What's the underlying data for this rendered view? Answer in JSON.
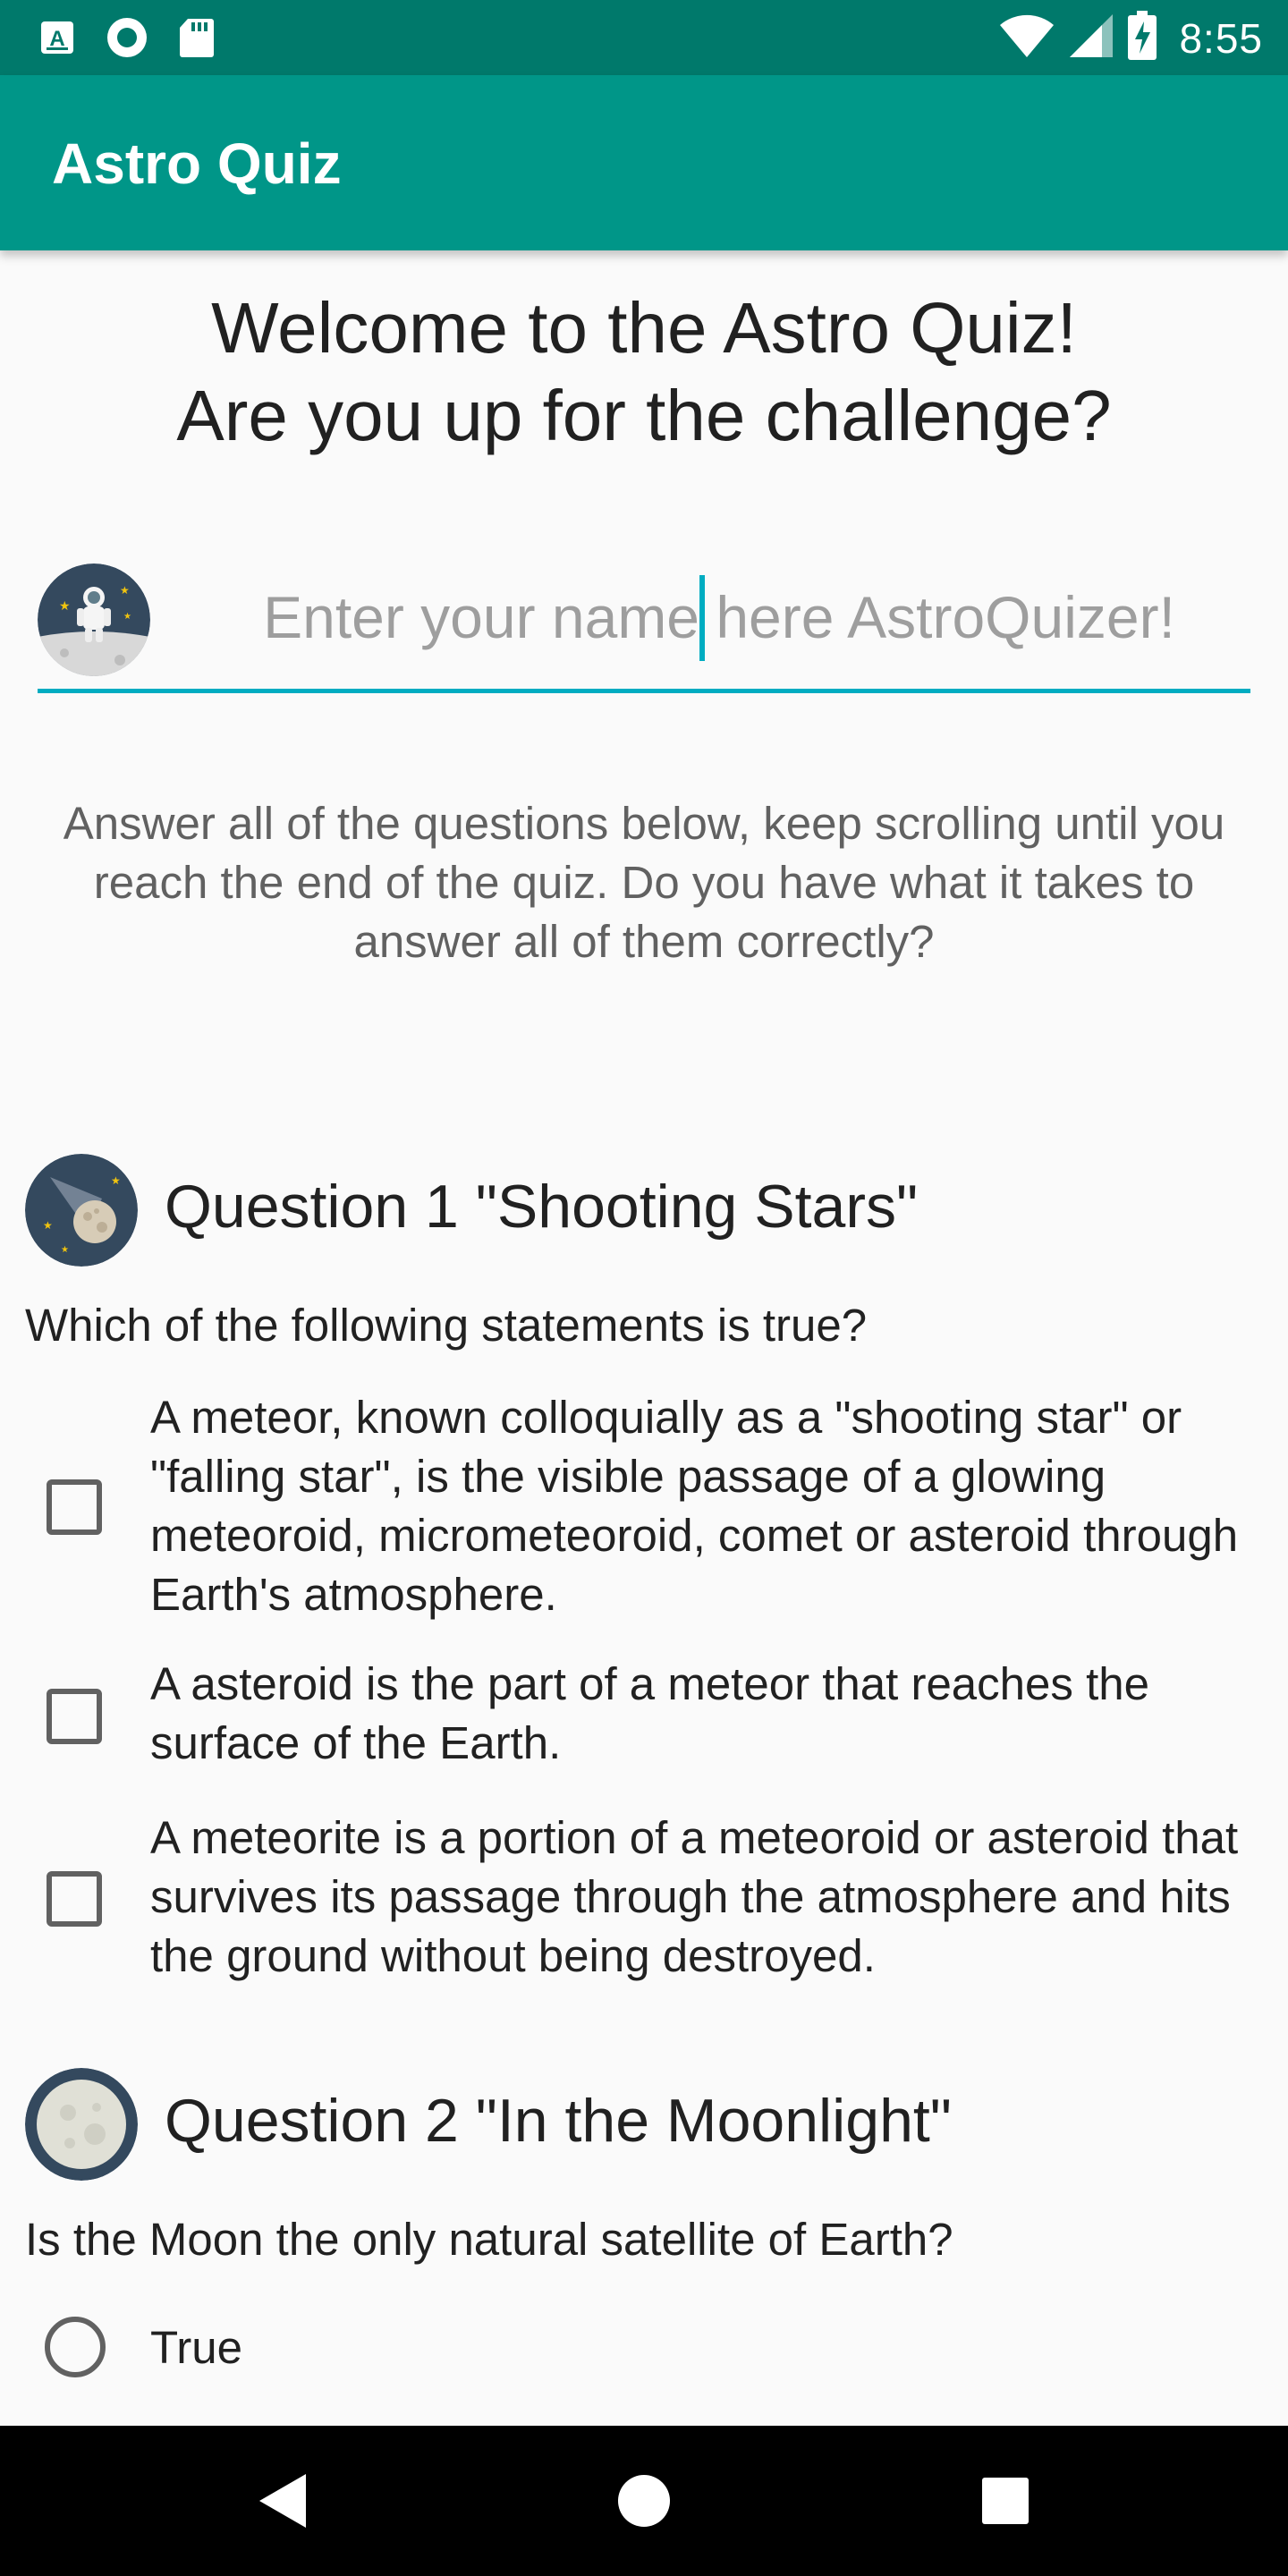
{
  "status_bar": {
    "time": "8:55",
    "left_icons": [
      "app-a-icon",
      "circle-app-icon",
      "sd-card-icon"
    ],
    "right_icons": [
      "wifi-icon",
      "signal-icon",
      "battery-charging-icon"
    ]
  },
  "app_bar": {
    "title": "Astro Quiz"
  },
  "welcome": {
    "line1": "Welcome to the Astro Quiz!",
    "line2": "Are you up for the challenge?"
  },
  "name_field": {
    "placeholder": "Enter your name here AstroQuizer!",
    "value": "",
    "icon": "astronaut-icon"
  },
  "intro_text": "Answer all of the questions below, keep scrolling until you reach the end of the quiz. Do you have what it takes to answer all of them correctly?",
  "questions": [
    {
      "icon": "meteor-icon",
      "title": "Question 1 \"Shooting Stars\"",
      "prompt": "Which of the following statements is true?",
      "type": "checkbox",
      "options": [
        {
          "label": "A meteor, known colloquially as a \"shooting star\" or \"falling star\", is the visible passage of a glowing meteoroid, micrometeoroid, comet or asteroid through Earth's atmosphere.",
          "checked": false
        },
        {
          "label": "A asteroid is the part of a meteor that reaches the surface of the Earth.",
          "checked": false
        },
        {
          "label": "A meteorite is a portion of a meteoroid or asteroid that survives its passage through the atmosphere and hits the ground without being destroyed.",
          "checked": false
        }
      ]
    },
    {
      "icon": "moon-icon",
      "title": "Question 2 \"In the Moonlight\"",
      "prompt": "Is the Moon the only natural satellite of Earth?",
      "type": "radio",
      "options": [
        {
          "label": "True",
          "checked": false
        }
      ]
    }
  ],
  "nav_bar": {
    "buttons": [
      "back-icon",
      "home-icon",
      "recents-icon"
    ]
  },
  "colors": {
    "status_bar": "#00796b",
    "app_bar": "#009688",
    "accent": "#00acc1",
    "icon_bg": "#34495e"
  }
}
